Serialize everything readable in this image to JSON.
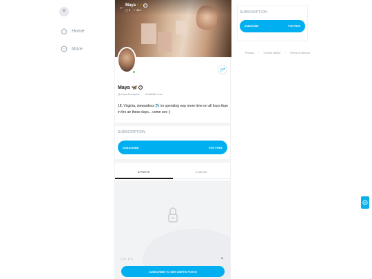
{
  "nav": {
    "items": [
      {
        "label": "Home",
        "icon": "home-icon"
      },
      {
        "label": "More",
        "icon": "more-icon"
      }
    ]
  },
  "header": {
    "name": "Maya 🦋",
    "photos_count": "8",
    "likes_count": "384"
  },
  "profile": {
    "name": "Maya 🦋",
    "handle": "@maya.thompson",
    "separator": "·",
    "status": "Available now",
    "bio": "18, Virginia, stewardess ✈️ im spending way more time on all fours than in the air these days... come see ;)"
  },
  "subscription": {
    "label": "SUBSCRIPTION",
    "button_left": "SUBSCRIBE",
    "button_right": "FOR FREE"
  },
  "tabs": [
    {
      "label": "8 POSTS",
      "active": true
    },
    {
      "label": "8 MEDIA",
      "active": false
    }
  ],
  "locked": {
    "photos_count": "4",
    "videos_count": "0",
    "cta": "SUBSCRIBE TO SEE USER'S POSTS"
  },
  "sidebar_right": {
    "label": "SUBSCRIPTION",
    "button_left": "SUBSCRIBE",
    "button_right": "FOR FREE"
  },
  "footer": {
    "links": [
      "Privacy",
      "Cookie Notice",
      "Terms of Service"
    ],
    "separator": "·"
  },
  "colors": {
    "accent": "#00aff0",
    "muted_text": "#8a96a3",
    "online": "#5fcb4f"
  }
}
